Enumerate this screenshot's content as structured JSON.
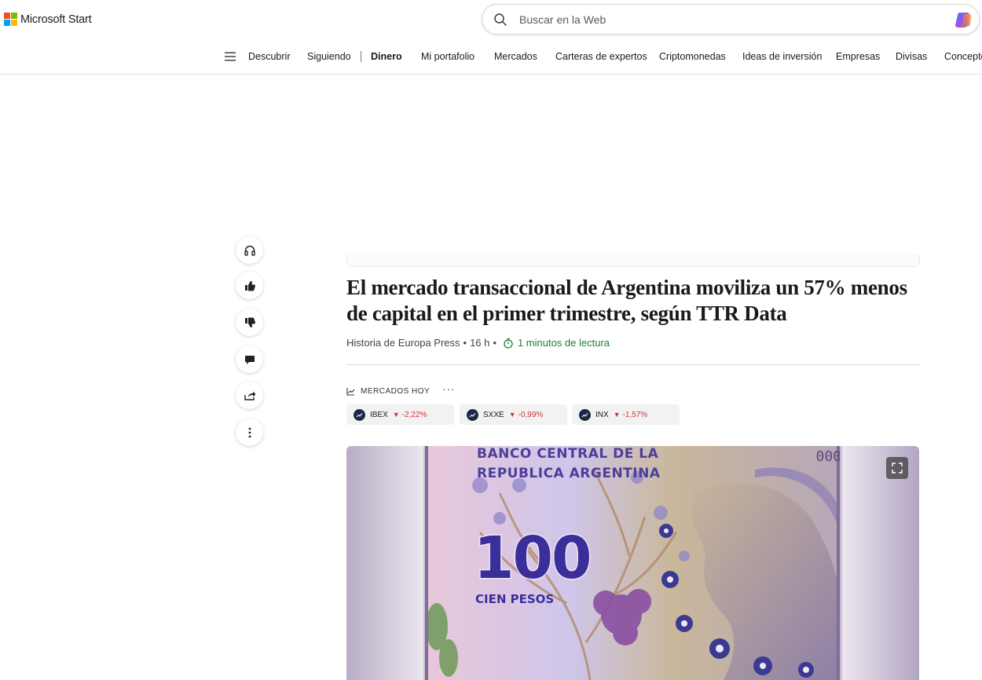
{
  "brand": {
    "name": "Microsoft Start",
    "colors": [
      "#f25022",
      "#7fba00",
      "#00a4ef",
      "#ffb900"
    ]
  },
  "search": {
    "placeholder": "Buscar en la Web",
    "value": ""
  },
  "nav": {
    "items": [
      {
        "label": "Descubrir",
        "active": false
      },
      {
        "label": "Siguiendo",
        "active": false
      },
      {
        "label": "Dinero",
        "active": true
      },
      {
        "label": "Mi portafolio",
        "active": false
      },
      {
        "label": "Mercados",
        "active": false
      },
      {
        "label": "Carteras de expertos",
        "active": false
      },
      {
        "label": "Criptomonedas",
        "active": false
      },
      {
        "label": "Ideas de inversión",
        "active": false
      },
      {
        "label": "Empresas",
        "active": false
      },
      {
        "label": "Divisas",
        "active": false
      },
      {
        "label": "Conceptos",
        "active": false
      }
    ]
  },
  "actions": [
    "headphones-icon",
    "thumbs-up-icon",
    "thumbs-down-icon",
    "comment-icon",
    "share-icon",
    "more-vertical-icon"
  ],
  "article": {
    "headline": "El mercado transaccional de Argentina moviliza un 57% menos de capital en el primer trimestre, según TTR Data",
    "source": "Historia de Europa Press",
    "age": "16 h",
    "read_time": "1 minutos de lectura"
  },
  "markets": {
    "title": "MERCADOS HOY",
    "more": "···",
    "tickers": [
      {
        "name": "IBEX",
        "change": "-2,22%"
      },
      {
        "name": "SXXE",
        "change": "-0,99%"
      },
      {
        "name": "INX",
        "change": "-1,57%"
      }
    ],
    "down_color": "#d13438"
  },
  "hero_image": {
    "banknote_line1": "BANCO CENTRAL DE LA",
    "banknote_line2": "REPUBLICA ARGENTINA",
    "denomination": "100",
    "denomination_words": "CIEN PESOS",
    "serial": "000"
  }
}
